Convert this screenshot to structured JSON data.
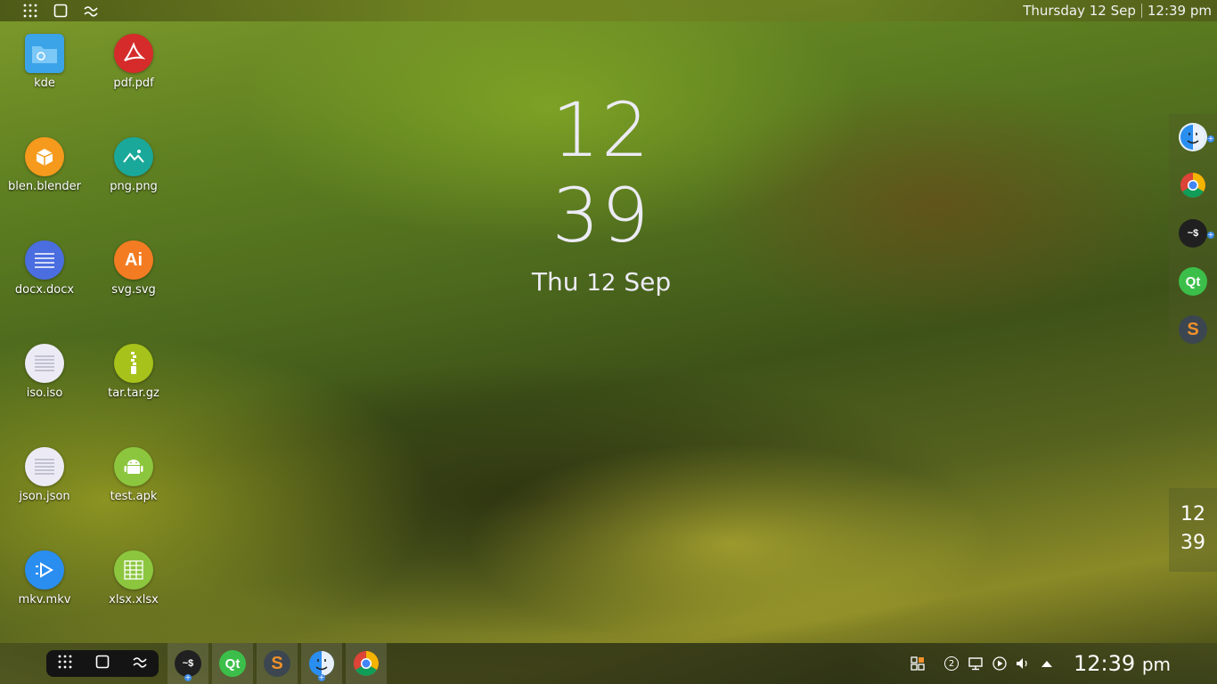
{
  "top_bar": {
    "date": "Thursday 12 Sep",
    "time": "12:39 pm"
  },
  "desktop_icons": [
    {
      "label": "kde",
      "icon": "folder-icon",
      "color": "#3ba3e8"
    },
    {
      "label": "pdf.pdf",
      "icon": "pdf-icon",
      "color": "#d52b2b"
    },
    {
      "label": "blen.blender",
      "icon": "blender-icon",
      "color": "#f59a1c"
    },
    {
      "label": "png.png",
      "icon": "image-icon",
      "color": "#1aa89a"
    },
    {
      "label": "docx.docx",
      "icon": "document-icon",
      "color": "#4a6ee0"
    },
    {
      "label": "svg.svg",
      "icon": "illustrator-icon",
      "color": "#f37c22",
      "glyph": "Ai"
    },
    {
      "label": "iso.iso",
      "icon": "text-file-icon",
      "color": "#ecebf5"
    },
    {
      "label": "tar.tar.gz",
      "icon": "archive-icon",
      "color": "#a7c21a"
    },
    {
      "label": "json.json",
      "icon": "text-file-icon",
      "color": "#ecebf5"
    },
    {
      "label": "test.apk",
      "icon": "android-icon",
      "color": "#8cc63e"
    },
    {
      "label": "mkv.mkv",
      "icon": "video-icon",
      "color": "#2a8ef0"
    },
    {
      "label": "xlsx.xlsx",
      "icon": "spreadsheet-icon",
      "color": "#8cc63e"
    }
  ],
  "big_clock": {
    "hour": "12",
    "minute": "39",
    "day": "Thu",
    "date_num": "12",
    "month": "Sep"
  },
  "right_dock": {
    "apps": [
      {
        "name": "finder-icon"
      },
      {
        "name": "chrome-icon"
      },
      {
        "name": "terminal-icon",
        "glyph": "~$"
      },
      {
        "name": "qt-icon",
        "glyph": "Qt"
      },
      {
        "name": "sublime-icon",
        "glyph": "S"
      }
    ],
    "clock_hour": "12",
    "clock_minute": "39"
  },
  "taskbar": {
    "apps": [
      {
        "name": "terminal-icon",
        "glyph": "~$"
      },
      {
        "name": "qt-icon",
        "glyph": "Qt"
      },
      {
        "name": "sublime-icon",
        "glyph": "S"
      },
      {
        "name": "finder-icon"
      },
      {
        "name": "chrome-icon"
      }
    ],
    "tray_badge": "2",
    "time": "12:39",
    "ampm": "pm"
  }
}
